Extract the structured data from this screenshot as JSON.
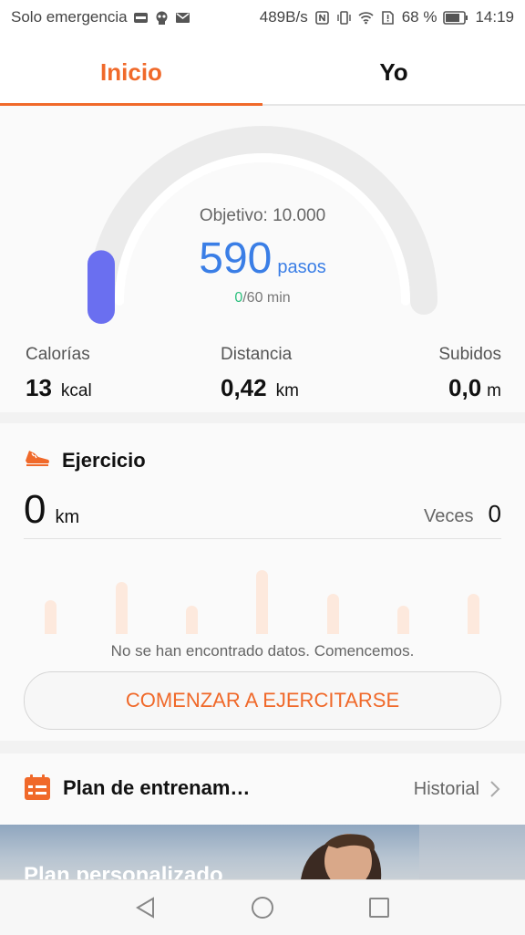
{
  "status_bar": {
    "carrier": "Solo emergencia",
    "speed": "489B/s",
    "battery": "68 %",
    "time": "14:19"
  },
  "tabs": [
    {
      "label": "Inicio",
      "active": true
    },
    {
      "label": "Yo",
      "active": false
    }
  ],
  "steps": {
    "goal_label": "Objetivo: 10.000",
    "count": "590",
    "unit": "pasos",
    "progress_fraction": 0.059,
    "minutes_done": "0",
    "minutes_goal": "/60 min"
  },
  "stats": [
    {
      "label": "Calorías",
      "value": "13",
      "unit": "kcal"
    },
    {
      "label": "Distancia",
      "value": "0,42",
      "unit": "km"
    },
    {
      "label": "Subidos",
      "value": "0,0",
      "unit": "m"
    }
  ],
  "exercise": {
    "title": "Ejercicio",
    "distance": "0",
    "distance_unit": "km",
    "times_label": "Veces",
    "times": "0",
    "no_data": "No se han encontrado datos. Comencemos.",
    "start_button": "COMENZAR A EJERCITARSE"
  },
  "plan": {
    "title": "Plan de entrenam…",
    "history": "Historial",
    "banner_text": "Plan personalizado"
  },
  "colors": {
    "accent": "#f0692a",
    "steps_blue": "#3a7ee6",
    "progress": "#6a6ff0",
    "minutes_green": "#2ec07f"
  }
}
